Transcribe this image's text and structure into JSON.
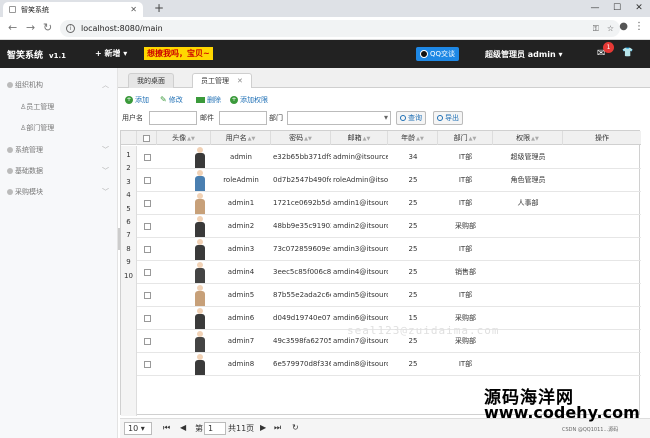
{
  "browser": {
    "tab_title": "智笑系统",
    "url": "localhost:8080/main"
  },
  "header": {
    "logo": "智笑系统",
    "version": "v1.1",
    "new_label": "新增",
    "marquee": "想撩我吗，宝贝~",
    "qq_label": "QQ交谈",
    "user_label": "超级管理员 admin",
    "mail_count": "1"
  },
  "sidebar": {
    "groups": [
      {
        "label": "组织机构",
        "items": [
          "员工管理",
          "部门管理"
        ]
      },
      {
        "label": "系统管理",
        "items": []
      },
      {
        "label": "基础数据",
        "items": []
      },
      {
        "label": "采购模块",
        "items": []
      }
    ]
  },
  "tabs": [
    {
      "label": "我的桌面"
    },
    {
      "label": "员工管理"
    }
  ],
  "toolbar": {
    "add": "添加",
    "edit": "修改",
    "delete": "删除",
    "add_perm": "添加权限"
  },
  "search": {
    "username_label": "用户名",
    "email_label": "邮件",
    "dept_label": "部门",
    "query_button": "查询",
    "export_button": "导出"
  },
  "table": {
    "columns": [
      "头像",
      "用户名",
      "密码",
      "邮箱",
      "年龄",
      "部门",
      "权限",
      "操作"
    ],
    "row_numbers": [
      "1",
      "2",
      "3",
      "4",
      "5",
      "6",
      "7",
      "8",
      "9",
      "10"
    ],
    "rows": [
      {
        "username": "admin",
        "password": "e32b65bb371df9",
        "email": "admin@itsource",
        "age": "34",
        "dept": "IT部",
        "perm": "超级管理员"
      },
      {
        "username": "roleAdmin",
        "password": "0d7b2547b490fe",
        "email": "roleAdmin@itsource",
        "age": "25",
        "dept": "IT部",
        "perm": "角色管理员"
      },
      {
        "username": "admin1",
        "password": "1721ce0692b5de",
        "email": "amdin1@itsource",
        "age": "25",
        "dept": "IT部",
        "perm": "人事部"
      },
      {
        "username": "admin2",
        "password": "48bb9e35c91902",
        "email": "amdin2@itsource",
        "age": "25",
        "dept": "采购部",
        "perm": ""
      },
      {
        "username": "admin3",
        "password": "73c072859609e7",
        "email": "amdin3@itsource",
        "age": "25",
        "dept": "IT部",
        "perm": ""
      },
      {
        "username": "admin4",
        "password": "3eec5c85f006c8",
        "email": "amdin4@itsource",
        "age": "25",
        "dept": "销售部",
        "perm": ""
      },
      {
        "username": "admin5",
        "password": "87b55e2ada2c6c",
        "email": "amdin5@itsource",
        "age": "25",
        "dept": "IT部",
        "perm": ""
      },
      {
        "username": "admin6",
        "password": "d049d19740e07e",
        "email": "amdin6@itsource",
        "age": "15",
        "dept": "采购部",
        "perm": ""
      },
      {
        "username": "admin7",
        "password": "49c3598fa62705",
        "email": "amdin7@itsource",
        "age": "25",
        "dept": "采购部",
        "perm": ""
      },
      {
        "username": "admin8",
        "password": "6e579970d8f336",
        "email": "amdin8@itsource",
        "age": "25",
        "dept": "IT部",
        "perm": ""
      }
    ],
    "avatar_colors": [
      "#3a3a3a",
      "#4a7fb0",
      "#c7a079",
      "#3a3a3a",
      "#3a3a3a",
      "#444444",
      "#c7a079",
      "#3a3a3a",
      "#444444",
      "#3a3a3a"
    ],
    "watermark": "seal123@zuidaima.com"
  },
  "pager": {
    "page_size": "10",
    "page_label": "第",
    "current_page": "1",
    "total_pages": "共11页"
  },
  "site": {
    "name": "源码海洋网",
    "url": "www.codehy.com",
    "credit": "CSDN @QQ1011...源码"
  }
}
